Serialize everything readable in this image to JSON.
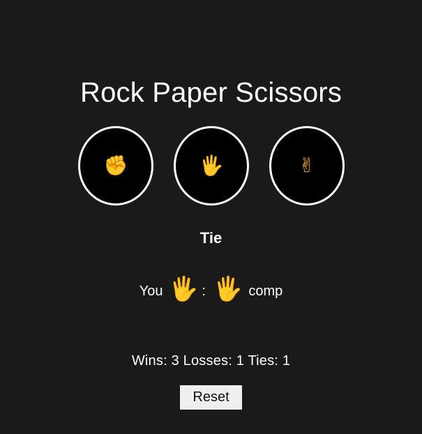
{
  "title": "Rock Paper Scissors",
  "choices": [
    {
      "name": "rock",
      "emoji": "✊"
    },
    {
      "name": "paper",
      "emoji": "🖐"
    },
    {
      "name": "scissors",
      "emoji": "✌"
    }
  ],
  "result": "Tie",
  "matchup": {
    "you_label": "You",
    "you_pick": "🖐",
    "separator": ":",
    "comp_pick": "🖐",
    "comp_label": "comp"
  },
  "score": {
    "text": "Wins: 3 Losses: 1 Ties: 1",
    "wins": 3,
    "losses": 1,
    "ties": 1
  },
  "reset_label": "Reset",
  "colors": {
    "background": "#1a1a1a",
    "circle_fill": "#000000",
    "circle_border": "#ffffff",
    "emoji": "#f5b731",
    "button": "#efefef"
  }
}
